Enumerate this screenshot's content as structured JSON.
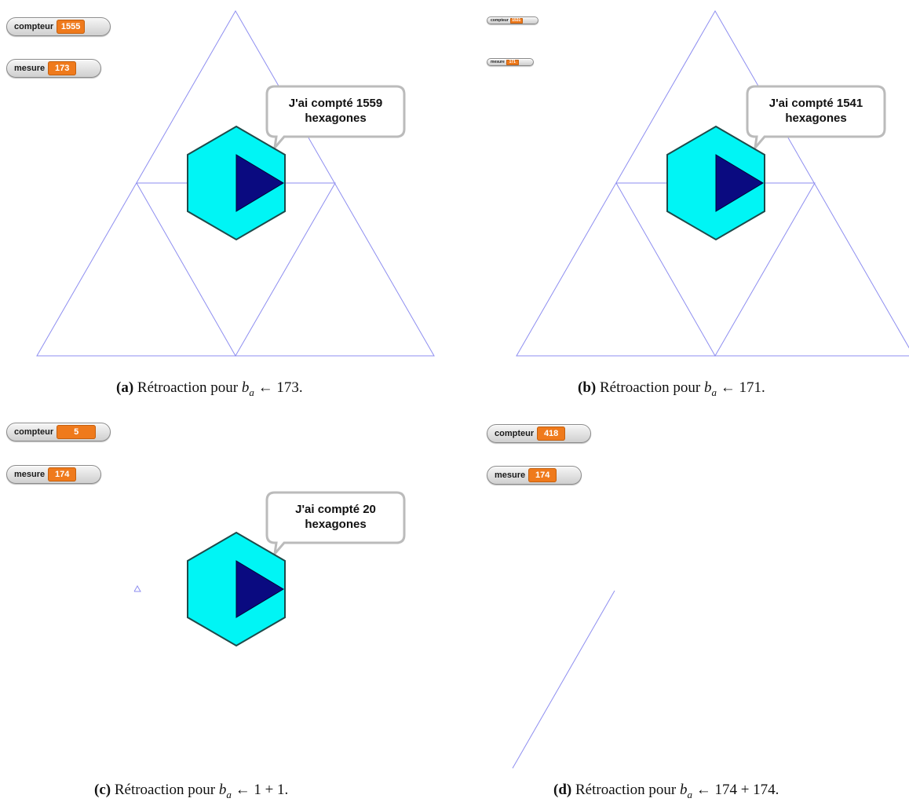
{
  "panels": [
    {
      "id": "a",
      "watchers": {
        "compteur": {
          "label": "compteur",
          "value": "1555"
        },
        "mesure": {
          "label": "mesure",
          "value": "173"
        }
      },
      "bubble": {
        "line1": "J'ai compté 1559",
        "line2": "hexagones"
      },
      "caption": {
        "tag": "(a)",
        "text": "Rétroaction pour",
        "var": "b",
        "sub": "a",
        "arrow": "←",
        "expr": "173."
      }
    },
    {
      "id": "b",
      "watchers": {
        "compteur": {
          "label": "compteur",
          "value": "1531"
        },
        "mesure": {
          "label": "mesure",
          "value": "171"
        }
      },
      "bubble": {
        "line1": "J'ai compté 1541",
        "line2": "hexagones"
      },
      "caption": {
        "tag": "(b)",
        "text": "Rétroaction pour",
        "var": "b",
        "sub": "a",
        "arrow": "←",
        "expr": "171."
      }
    },
    {
      "id": "c",
      "watchers": {
        "compteur": {
          "label": "compteur",
          "value": "5"
        },
        "mesure": {
          "label": "mesure",
          "value": "174"
        }
      },
      "bubble": {
        "line1": "J'ai compté 20",
        "line2": "hexagones"
      },
      "caption": {
        "tag": "(c)",
        "text": "Rétroaction pour",
        "var": "b",
        "sub": "a",
        "arrow": "←",
        "expr": "1 + 1."
      }
    },
    {
      "id": "d",
      "watchers": {
        "compteur": {
          "label": "compteur",
          "value": "418"
        },
        "mesure": {
          "label": "mesure",
          "value": "174"
        }
      },
      "caption": {
        "tag": "(d)",
        "text": "Rétroaction pour",
        "var": "b",
        "sub": "a",
        "arrow": "←",
        "expr": "174 + 174."
      }
    }
  ],
  "colors": {
    "stroke": "#8e8ef0",
    "hexagon": "#00f5f5",
    "play": "#0a0a80",
    "watcher_value": "#ef7a1c",
    "bubble_border": "#bbbbbb"
  },
  "icons": {
    "sprite": "hexagon-play-icon"
  }
}
